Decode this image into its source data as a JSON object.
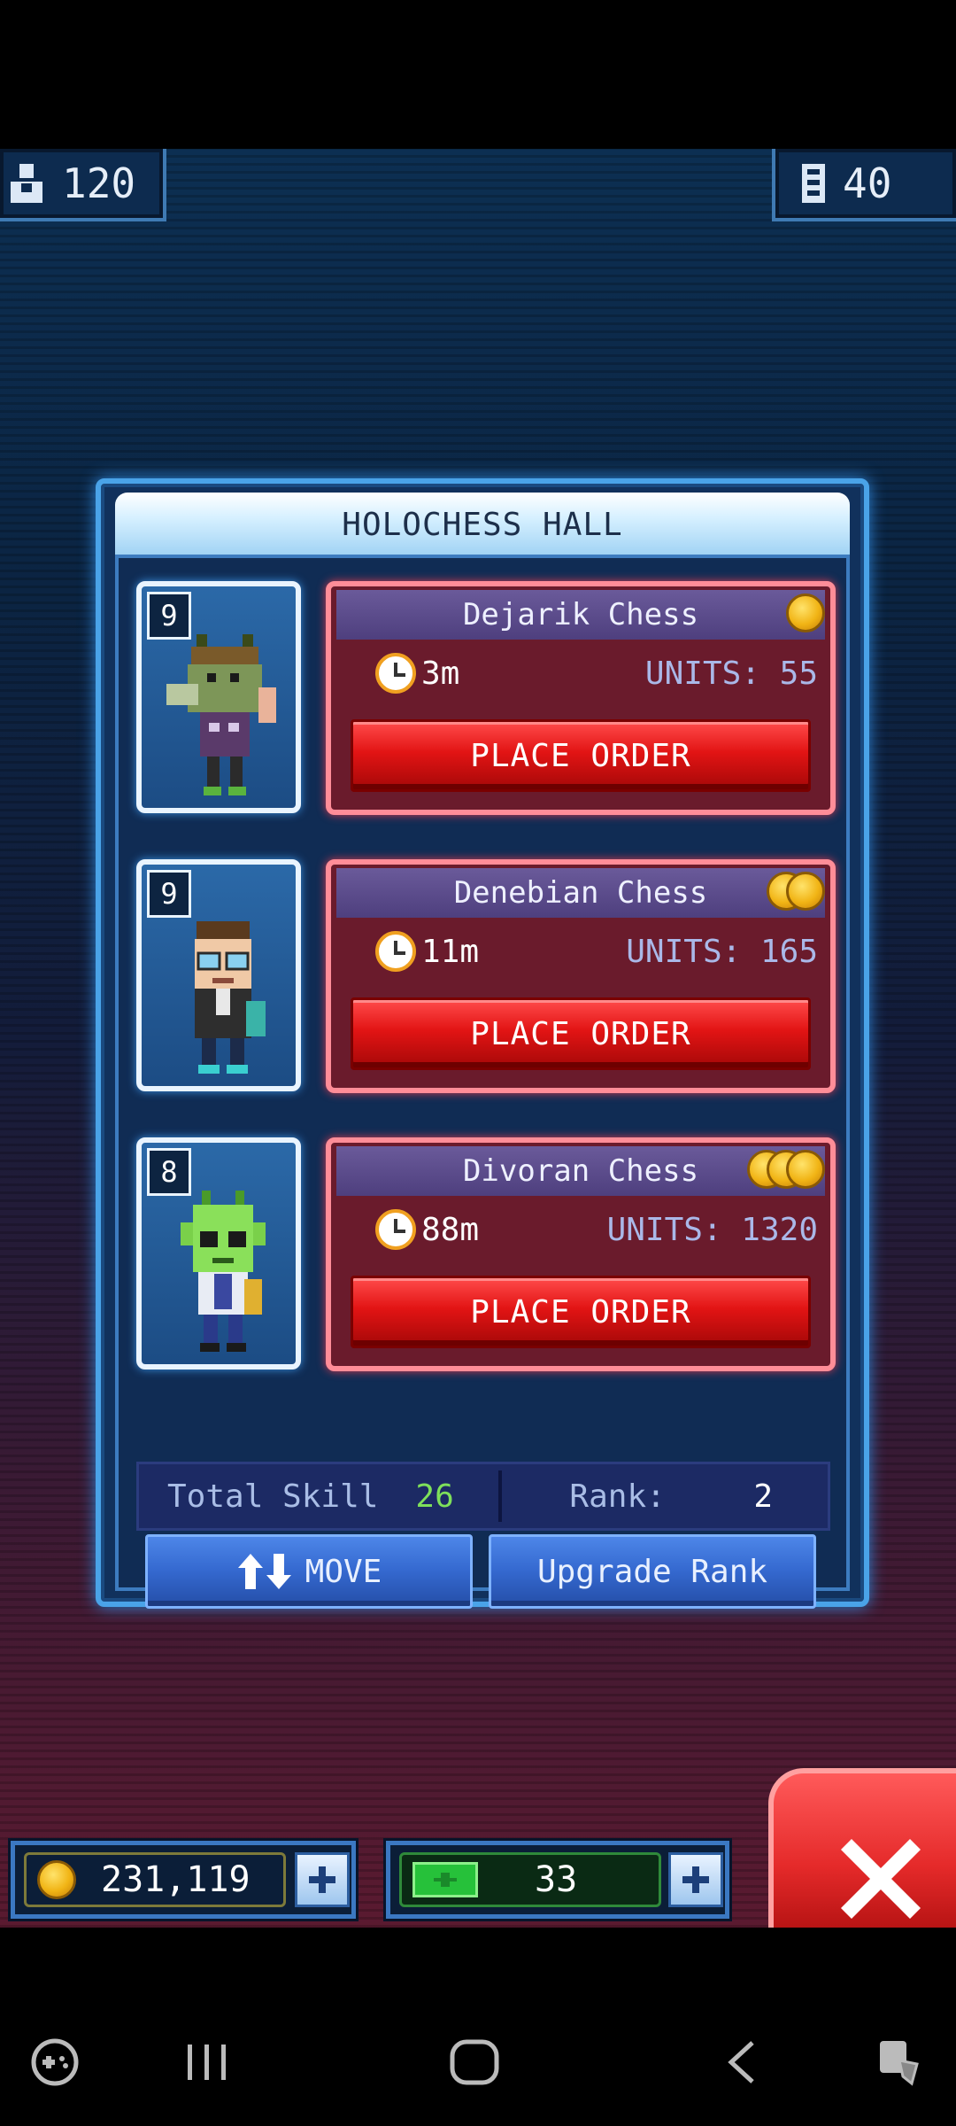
{
  "top_stats": {
    "population": "120",
    "floors": "40"
  },
  "panel": {
    "title": "HOLOCHESS HALL",
    "orders": [
      {
        "level": "9",
        "name": "Dejarik Chess",
        "coins": 1,
        "time": "3m",
        "units": "UNITS: 55",
        "button": "PLACE ORDER"
      },
      {
        "level": "9",
        "name": "Denebian Chess",
        "coins": 2,
        "time": "11m",
        "units": "UNITS: 165",
        "button": "PLACE ORDER"
      },
      {
        "level": "8",
        "name": "Divoran Chess",
        "coins": 3,
        "time": "88m",
        "units": "UNITS: 1320",
        "button": "PLACE ORDER"
      }
    ],
    "total_skill_label": "Total Skill",
    "total_skill_value": "26",
    "rank_label": "Rank:",
    "rank_value": "2",
    "move_label": "MOVE",
    "upgrade_label": "Upgrade Rank"
  },
  "bottom_bar": {
    "coins": "231,119",
    "bux": "33"
  },
  "colors": {
    "accent_blue": "#4aa3e8",
    "order_red": "#e21414",
    "skill_green": "#7ee05a",
    "coin_gold": "#f1b415"
  },
  "icons": {
    "population": "person-icon",
    "floors": "floors-icon",
    "clock": "clock-icon",
    "coin": "coin-icon",
    "bux": "bux-icon",
    "plus": "plus-icon",
    "close": "close-icon",
    "move": "move-arrows-icon"
  }
}
